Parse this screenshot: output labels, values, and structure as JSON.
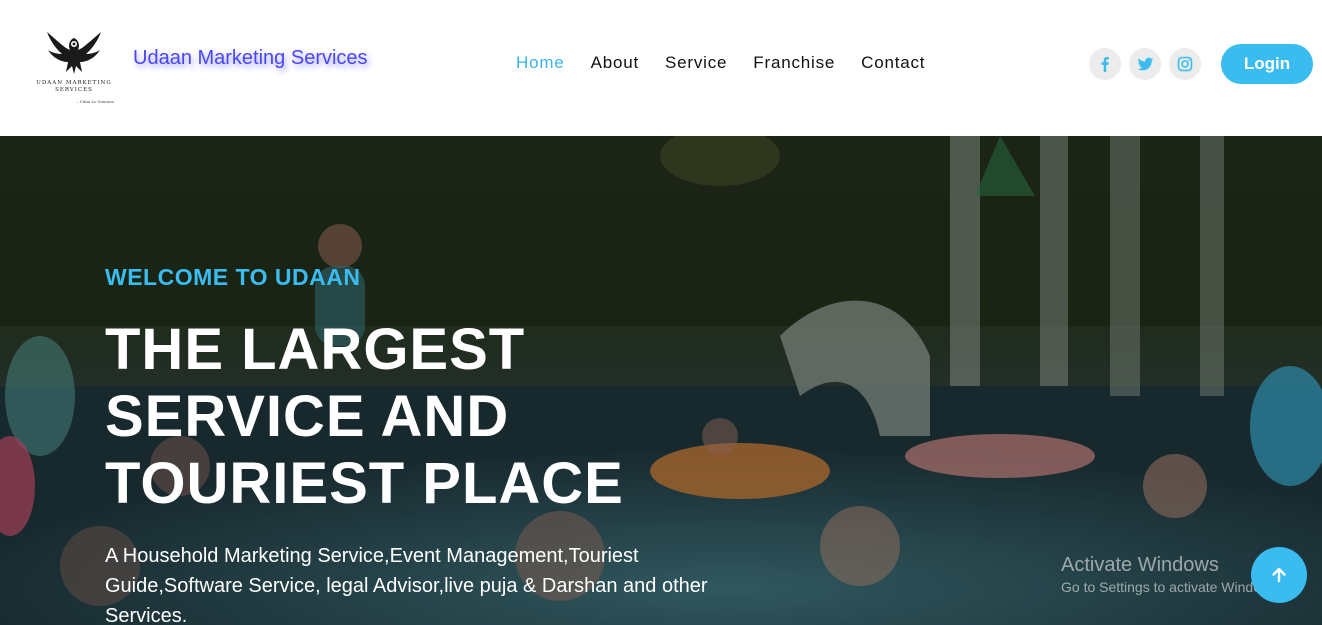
{
  "header": {
    "logo": {
      "icon": "eagle-logo-icon",
      "wordmark": "UDAAN MARKETING SERVICES",
      "tagline": "...Udaa Le Samnae"
    },
    "brand": "Udaan Marketing Services",
    "nav": [
      {
        "label": "Home",
        "active": true
      },
      {
        "label": "About",
        "active": false
      },
      {
        "label": "Service",
        "active": false
      },
      {
        "label": "Franchise",
        "active": false
      },
      {
        "label": "Contact",
        "active": false
      }
    ],
    "social": [
      {
        "icon": "facebook-icon"
      },
      {
        "icon": "twitter-icon"
      },
      {
        "icon": "instagram-icon"
      }
    ],
    "login_label": "Login"
  },
  "hero": {
    "eyebrow": "WELCOME TO UDAAN",
    "headline": "THE LARGEST SERVICE AND TOURIEST PLACE",
    "description": "A Household Marketing Service,Event Management,Touriest Guide,Software Service, legal Advisor,live puja & Darshan and other Services.",
    "background": "pool-party-photo"
  },
  "overlay": {
    "activate_title": "Activate Windows",
    "activate_sub": "Go to Settings to activate Windows."
  },
  "scroll_top": {
    "icon": "arrow-up-icon"
  },
  "colors": {
    "accent": "#3bbcf0",
    "brand_text": "#4a47f5",
    "nav_active": "#3ab4ea",
    "social_bg": "#ececec"
  }
}
